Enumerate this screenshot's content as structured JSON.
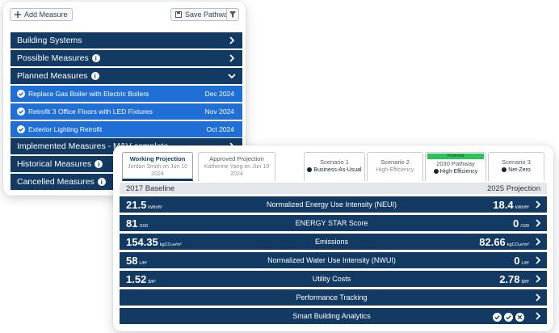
{
  "left_panel": {
    "add_measure": "Add Measure",
    "save_pathway": "Save Pathway",
    "sections": {
      "building_systems": "Building Systems",
      "possible_measures": "Possible Measures",
      "planned_measures": "Planned Measures",
      "implemented_measures": "Implemented Measures - M&V complete",
      "historical_measures": "Historical Measures",
      "cancelled_measures": "Cancelled Measures"
    },
    "planned": [
      {
        "name": "Replace Gas Boiler with Electric Boilers",
        "date": "Dec 2024"
      },
      {
        "name": "Retrofit 3 Office Floors with LED Fixtures",
        "date": "Nov 2024"
      },
      {
        "name": "Exterior Lighting Retrofit",
        "date": "Oct 2024"
      }
    ]
  },
  "right_panel": {
    "tabs": {
      "working": {
        "title": "Working Projection",
        "sub1": "Jordan Smith on Jun 10",
        "sub2": "2024"
      },
      "approved": {
        "title": "Approved Projection",
        "sub1": "Katherine Yang on Jun 10",
        "sub2": "2024"
      },
      "s1": {
        "title": "Scenario 1",
        "sub": "Business-As-Usual"
      },
      "s2": {
        "title": "Scenario 2",
        "sub": "High-Efficiency"
      },
      "p2030": {
        "badge": "Preferred",
        "title": "2030 Pathway",
        "sub": "High-Efficiency"
      },
      "s3": {
        "title": "Scenario 3",
        "sub": "Net-Zero"
      }
    },
    "baseline_label": "2017 Baseline",
    "projection_label": "2025 Projection",
    "rows": {
      "neui": {
        "metric": "Normalized Energy Use Intensity (NEUI)",
        "base": "21.5",
        "base_unit": "kWh/ft²",
        "proj": "18.4",
        "proj_unit": "kWh/ft²"
      },
      "energy_star": {
        "metric": "ENERGY STAR Score",
        "base": "81",
        "base_unit": "/100",
        "proj": "0",
        "proj_unit": "/100"
      },
      "emissions": {
        "metric": "Emissions",
        "base": "154.35",
        "base_unit": "kgCO₂e/m²",
        "proj": "82.66",
        "proj_unit": "kgCO₂e/m²"
      },
      "nwui": {
        "metric": "Normalized Water Use Intensity (NWUI)",
        "base": "58",
        "base_unit": "L/ft²",
        "proj": "0",
        "proj_unit": "L/ft²"
      },
      "utility": {
        "metric": "Utility Costs",
        "base": "1.52",
        "base_unit": "$/ft²",
        "proj": "2.78",
        "proj_unit": "$/ft²"
      },
      "performance": {
        "metric": "Performance Tracking"
      },
      "smart": {
        "metric": "Smart Building Analytics"
      }
    }
  },
  "colors": {
    "navy": "#133a63",
    "blue": "#1f6fd6",
    "preferred": "#2bc25a"
  }
}
